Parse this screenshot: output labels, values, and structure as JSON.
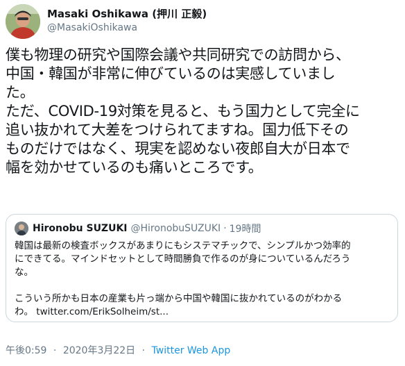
{
  "author": {
    "name": "Masaki Oshikawa (押川 正毅)",
    "handle": "@MasakiOshikawa"
  },
  "tweet": {
    "text": "僕も物理の研究や国際会議や共同研究での訪問から、\n中国・韓国が非常に伸びているのは実感していまし\nた。\nただ、COVID-19対策を見ると、もう国力として完全に\n追い抜かれて大差をつけられてますね。国力低下その\nものだけではなく、現実を認めない夜郎自大が日本で\n幅を効かせているのも痛いところです。"
  },
  "quoted": {
    "name": "Hironobu SUZUKI",
    "handle": "@HironobuSUZUKI",
    "separator": "·",
    "time": "19時間",
    "text": "韓国は最新の検査ボックスがあまりにもシステマチックで、シンプルかつ効率的\nにできてる。マインドセットとして時間勝負で作るのが身についているんだろう\nな。\n\nこういう所かも日本の産業も片っ端から中国や韓国に抜かれているのがわかる\nわ。 ",
    "link": "twitter.com/ErikSolheim/st..."
  },
  "meta": {
    "time": "午後0:59",
    "separator": "·",
    "date": "2020年3月22日",
    "app": "Twitter Web App"
  },
  "colors": {
    "text": "#14171a",
    "secondary": "#657786",
    "link": "#1b95e0",
    "border": "#ccd6dd"
  }
}
